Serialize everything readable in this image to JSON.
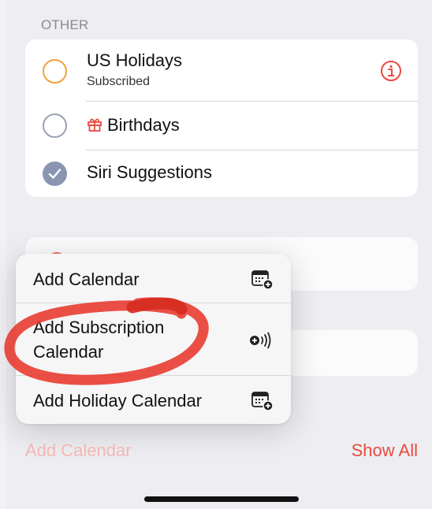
{
  "section": {
    "header": "OTHER"
  },
  "calendars": [
    {
      "title": "US Holidays",
      "subtitle": "Subscribed",
      "state": "unchecked",
      "ring_color": "#f1a33a",
      "has_info": true
    },
    {
      "title": "Birthdays",
      "state": "unchecked",
      "ring_color": "#9aa3b5",
      "icon": "gift-icon"
    },
    {
      "title": "Siri Suggestions",
      "state": "checked",
      "fill_color": "#8995b1"
    }
  ],
  "menu": {
    "items": [
      {
        "label": "Add Calendar",
        "icon": "calendar-add-icon"
      },
      {
        "label_line1": "Add Subscription",
        "label_line2": "Calendar",
        "icon": "subscription-broadcast-icon"
      },
      {
        "label": "Add Holiday Calendar",
        "icon": "calendar-add-icon"
      }
    ]
  },
  "footer": {
    "add_calendar": "Add Calendar",
    "show_all": "Show All"
  },
  "colors": {
    "accent": "#e84b3f",
    "annotation": "#e8382c"
  }
}
